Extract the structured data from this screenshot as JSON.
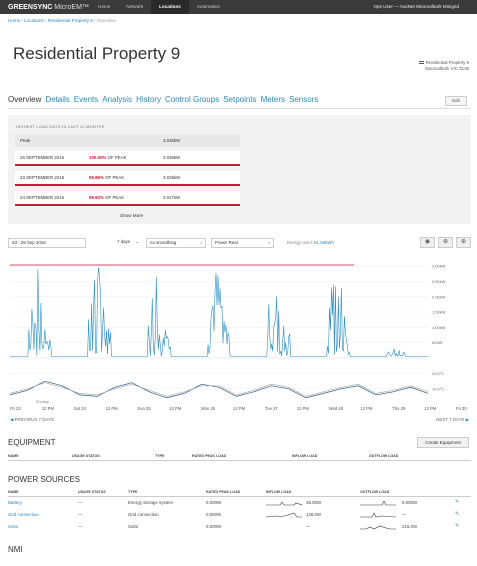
{
  "topbar": {
    "brand_bold": "GREENSYNC",
    "brand_light": "MicroEM™",
    "nav": [
      "Home",
      "Network",
      "Locations",
      "Automation"
    ],
    "active_nav": "Locations",
    "ops_user": "Ops User — AusNet Mooroolbark Minigrid"
  },
  "breadcrumb": {
    "home": "Home",
    "locations": "Locations",
    "property": "Residential Property 9",
    "current": "Overview",
    "sep": "/"
  },
  "page_title": "Residential Property 9",
  "address": {
    "line1": "Residential Property 9",
    "line2": "Mooroolbark VIC 3138"
  },
  "tabs": [
    "Overview",
    "Details",
    "Events",
    "Analysis",
    "History",
    "Control Groups",
    "Setpoints",
    "Meters",
    "Sensors"
  ],
  "active_tab": "Overview",
  "edit_label": "Edit",
  "peak": {
    "header": "HIGHEST LOAD DAYS IN LAST 12 MONTHS",
    "peak_label": "Peak",
    "peak_value": "3.036kW",
    "rows": [
      {
        "date": "26 SEPTEMBER 2016",
        "pct": "100.00%",
        "suffix": " OF PEAK",
        "value": "3.036kW"
      },
      {
        "date": "23 SEPTEMBER 2016",
        "pct": "99.86%",
        "suffix": " OF PEAK",
        "value": "3.028kW"
      },
      {
        "date": "24 SEPTEMBER 2016",
        "pct": "99.83%",
        "suffix": " OF PEAK",
        "value": "3.027kW"
      }
    ],
    "show_more": "Show More"
  },
  "controls": {
    "date_range": "23 - 29 Sep 2016",
    "period": "7 days",
    "smoothing": "no smoothing",
    "metric": "Power Real",
    "energy_label": "Energy used: ",
    "energy_value": "61.58kWh",
    "caret": "↕",
    "period_caret": "⌄"
  },
  "chart_data": {
    "type": "line",
    "x_ticks": [
      "Fri 23",
      "12 PM",
      "Sat 24",
      "12 PM",
      "Sun 25",
      "12 PM",
      "Mon 26",
      "12 PM",
      "Tue 27",
      "12 PM",
      "Wed 28",
      "12 PM",
      "Thu 29",
      "12 PM",
      "Fri 30"
    ],
    "power_ticks": [
      "3.00kW",
      "2.50kW",
      "2.00kW",
      "1.50kW",
      "1.00kW",
      "500W"
    ],
    "power_ylim": [
      0,
      3.2
    ],
    "temp_ticks": [
      "20.0°C",
      "10.0°C"
    ],
    "temp_ylim": [
      0,
      25
    ],
    "peak_line_kw": 3.036,
    "peak_line_color": "#c91b3a",
    "power_color": "#2a8fc4",
    "temp_colors": [
      "#2a5d8c",
      "#aaaaaa"
    ],
    "annotation": "Sunday",
    "daily_peaks_kw": [
      3.0,
      3.03,
      3.0,
      2.95,
      2.9,
      2.95,
      0.3
    ],
    "temp_days_c": [
      [
        6,
        9,
        15,
        12,
        6,
        5,
        11,
        14,
        8,
        4,
        7,
        13,
        11,
        5,
        8,
        12,
        10,
        4,
        7,
        10,
        12,
        6,
        8,
        11,
        7
      ],
      [
        7,
        10,
        14,
        11,
        7,
        6,
        10,
        13,
        9,
        5,
        8,
        12,
        12,
        6,
        9,
        13,
        11,
        5,
        8,
        11,
        13,
        7,
        9,
        12,
        8
      ]
    ]
  },
  "prev_label": "PREVIOUS 7 DAYS",
  "next_label": "NEXT 7 DAYS",
  "equipment": {
    "title": "EQUIPMENT",
    "create_label": "Create Equipment",
    "headers": [
      "NAME",
      "USAGE STATUS",
      "TYPE",
      "RATED PEAK LOAD",
      "INFLOW LOAD",
      "OUTFLOW LOAD"
    ]
  },
  "power_sources": {
    "title": "POWER SOURCES",
    "headers": [
      "NAME",
      "USAGE STATUS",
      "TYPE",
      "RATED PEAK LOAD",
      "INFLOW LOAD",
      "OUTFLOW LOAD"
    ],
    "rows": [
      {
        "name": "Battery",
        "status": "—",
        "type": "Energy storage system",
        "rated": "0.000W",
        "inflow": "35.00W",
        "outflow": "0.000W"
      },
      {
        "name": "Grid connection",
        "status": "—",
        "type": "Grid connection",
        "rated": "0.000W",
        "inflow": "126.0W",
        "outflow": "—"
      },
      {
        "name": "Solar",
        "status": "—",
        "type": "Solar",
        "rated": "0.000W",
        "inflow": "—",
        "outflow": "215.0W"
      }
    ]
  },
  "nmi_title": "NMI"
}
